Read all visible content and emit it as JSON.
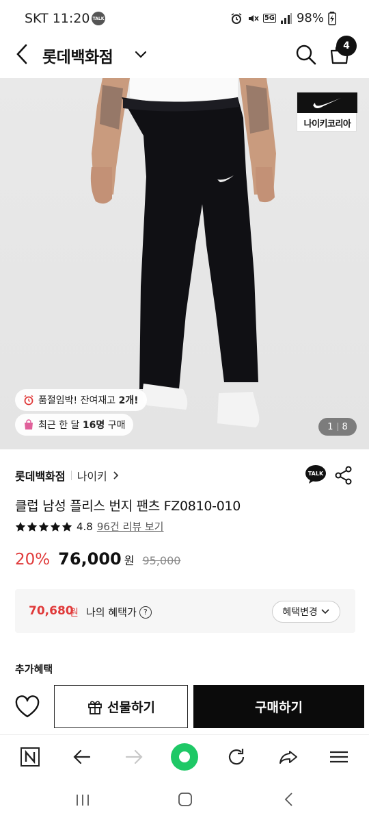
{
  "status_bar": {
    "time": "SKT 11:20",
    "talk_badge": "TALK",
    "network": "5G",
    "battery": "98%"
  },
  "header": {
    "title": "롯데백화점",
    "cart_count": "4"
  },
  "hero": {
    "brand_badge_label": "나이키코리아",
    "stock_text_prefix": "품절임박! 잔여재고 ",
    "stock_text_bold": "2개!",
    "buyers_text_prefix": "최근 한 달 ",
    "buyers_text_bold": "16명",
    "buyers_text_suffix": " 구매",
    "page_current": "1",
    "page_total": "8"
  },
  "product": {
    "seller": "롯데백화점",
    "brand": "나이키",
    "name": "클럽 남성 플리스 번지 팬츠 FZ0810-010",
    "rating": "4.8",
    "review_link": "96건 리뷰 보기",
    "discount": "20%",
    "price": "76,000",
    "price_unit": "원",
    "original_price": "95,000",
    "talk_label": "TALK"
  },
  "benefit": {
    "price": "70,680",
    "unit": "원",
    "label": "나의 혜택가",
    "change_label": "혜택변경"
  },
  "extra": {
    "label": "추가혜택"
  },
  "actions": {
    "gift_label": "선물하기",
    "buy_label": "구매하기"
  },
  "colors": {
    "accent_red": "#e03a3a",
    "buy_button": "#0b0b0b",
    "nav_green": "#1ec866"
  }
}
